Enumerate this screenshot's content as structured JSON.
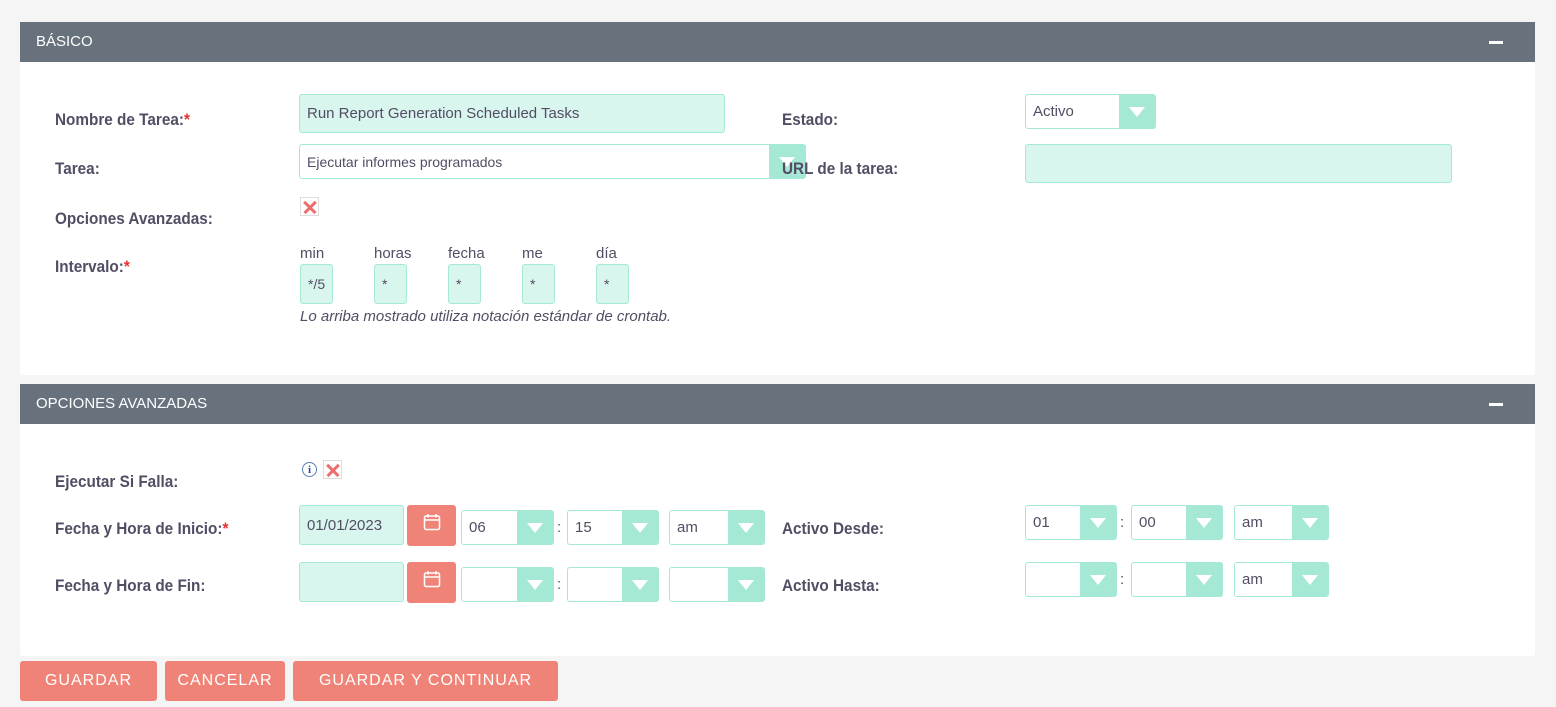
{
  "basic": {
    "title": "BÁSICO",
    "task_name_label": "Nombre de Tarea:",
    "task_name_value": "Run Report Generation Scheduled Tasks",
    "status_label": "Estado:",
    "status_value": "Activo",
    "job_label": "Tarea:",
    "job_value": "Ejecutar informes programados",
    "job_url_label": "URL de la tarea:",
    "job_url_value": "",
    "advanced_label": "Opciones Avanzadas:",
    "interval_label": "Intervalo:",
    "interval": {
      "min_label": "min",
      "min_value": "*/5",
      "hours_label": "horas",
      "hours_value": "*",
      "date_label": "fecha",
      "date_value": "*",
      "month_label": "me",
      "month_value": "*",
      "day_label": "día",
      "day_value": "*"
    },
    "cron_hint": "Lo arriba mostrado utiliza notación estándar de crontab."
  },
  "advanced": {
    "title": "OPCIONES AVANZADAS",
    "catch_up_label": "Ejecutar Si Falla:",
    "start_label": "Fecha y Hora de Inicio:",
    "start_date": "01/01/2023",
    "start_hour": "06",
    "start_minute": "15",
    "start_meridiem": "am",
    "end_label": "Fecha y Hora de Fin:",
    "end_date": "",
    "end_hour": "",
    "end_minute": "",
    "end_meridiem": "",
    "active_from_label": "Activo Desde:",
    "from_hour": "01",
    "from_minute": "00",
    "from_meridiem": "am",
    "active_to_label": "Activo Hasta:",
    "to_hour": "",
    "to_minute": "",
    "to_meridiem": "am",
    "colon": ":"
  },
  "required_mark": "*",
  "buttons": {
    "save": "GUARDAR",
    "cancel": "CANCELAR",
    "save_continue": "GUARDAR Y CONTINUAR"
  },
  "colors": {
    "header_bg": "#67727d",
    "field_bg": "#d8f5ee",
    "field_border": "#a5e8d6",
    "button_bg": "#f08377",
    "required": "#ea2e2e"
  },
  "icons": {
    "calendar": "calendar-icon",
    "dropdown": "chevron-down-icon",
    "collapse": "minus-icon",
    "checkbox": "x-mark-icon",
    "info": "info-icon"
  }
}
